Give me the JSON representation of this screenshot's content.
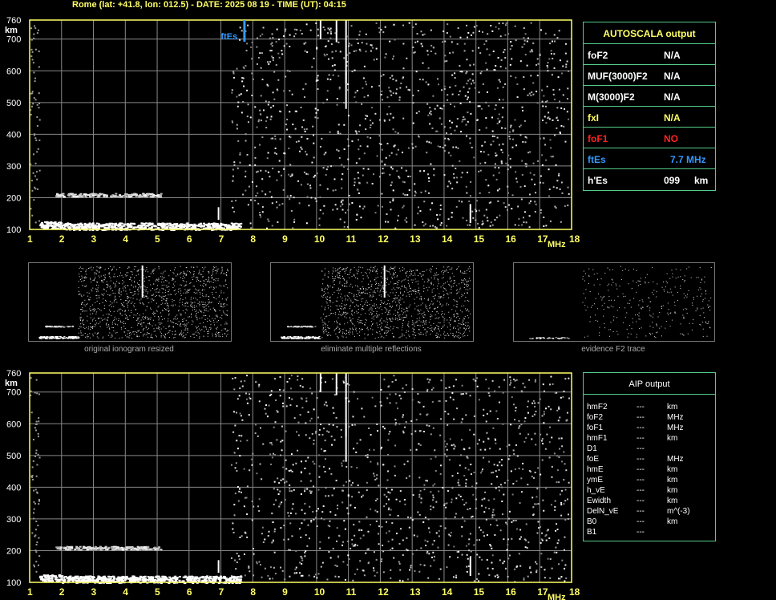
{
  "header": {
    "title": "Rome (lat: +41.8, lon: 012.5) - DATE: 2025 08 19 - TIME (UT): 04:15"
  },
  "axes": {
    "y_unit": "km",
    "x_unit": "MHz",
    "y_ticks": [
      "100",
      "200",
      "300",
      "400",
      "500",
      "600",
      "700",
      "760"
    ],
    "x_ticks": [
      "1",
      "2",
      "3",
      "4",
      "5",
      "6",
      "7",
      "8",
      "9",
      "10",
      "11",
      "12",
      "13",
      "14",
      "15",
      "16",
      "17",
      "18"
    ]
  },
  "ionogram_top": {
    "marker_label": "ftEs"
  },
  "autoscala": {
    "title": "AUTOSCALA output",
    "rows": [
      {
        "key": "foF2",
        "value": "N/A",
        "unit": "",
        "color": "#ffffff"
      },
      {
        "key": "MUF(3000)F2",
        "value": "N/A",
        "unit": "",
        "color": "#ffffff"
      },
      {
        "key": "M(3000)F2",
        "value": "N/A",
        "unit": "",
        "color": "#ffffff"
      },
      {
        "key": "fxI",
        "value": "N/A",
        "unit": "",
        "color": "#ffff66"
      },
      {
        "key": "foF1",
        "value": "NO",
        "unit": "",
        "color": "#ff2222"
      },
      {
        "key": "ftEs",
        "value": "7.7 MHz",
        "unit": "",
        "color": "#3399ff"
      },
      {
        "key": "h'Es",
        "value": "099",
        "unit": "km",
        "color": "#ffffff"
      }
    ]
  },
  "thumbnails": {
    "captions": [
      "original ionogram resized",
      "eliminate multiple reflections",
      "evidence F2 trace"
    ]
  },
  "aip": {
    "title": "AIP output",
    "rows": [
      {
        "key": "hmF2",
        "value": "---",
        "unit": "km"
      },
      {
        "key": "foF2",
        "value": "---",
        "unit": "MHz"
      },
      {
        "key": "foF1",
        "value": "---",
        "unit": "MHz"
      },
      {
        "key": "hmF1",
        "value": "---",
        "unit": "km"
      },
      {
        "key": "D1",
        "value": "---",
        "unit": ""
      },
      {
        "key": "foE",
        "value": "---",
        "unit": "MHz"
      },
      {
        "key": "hmE",
        "value": "---",
        "unit": "km"
      },
      {
        "key": "ymE",
        "value": "---",
        "unit": "km"
      },
      {
        "key": "h_vE",
        "value": "---",
        "unit": "km"
      },
      {
        "key": "Ewidth",
        "value": "---",
        "unit": "km"
      },
      {
        "key": "DelN_vE",
        "value": "---",
        "unit": "m^(-3)"
      },
      {
        "key": "B0",
        "value": "---",
        "unit": "km"
      },
      {
        "key": "B1",
        "value": "---",
        "unit": ""
      }
    ]
  },
  "colors": {
    "grid": "#888888",
    "frame": "#ffff66",
    "accent_blue": "#3399ff",
    "panel_border": "#55cc88"
  }
}
